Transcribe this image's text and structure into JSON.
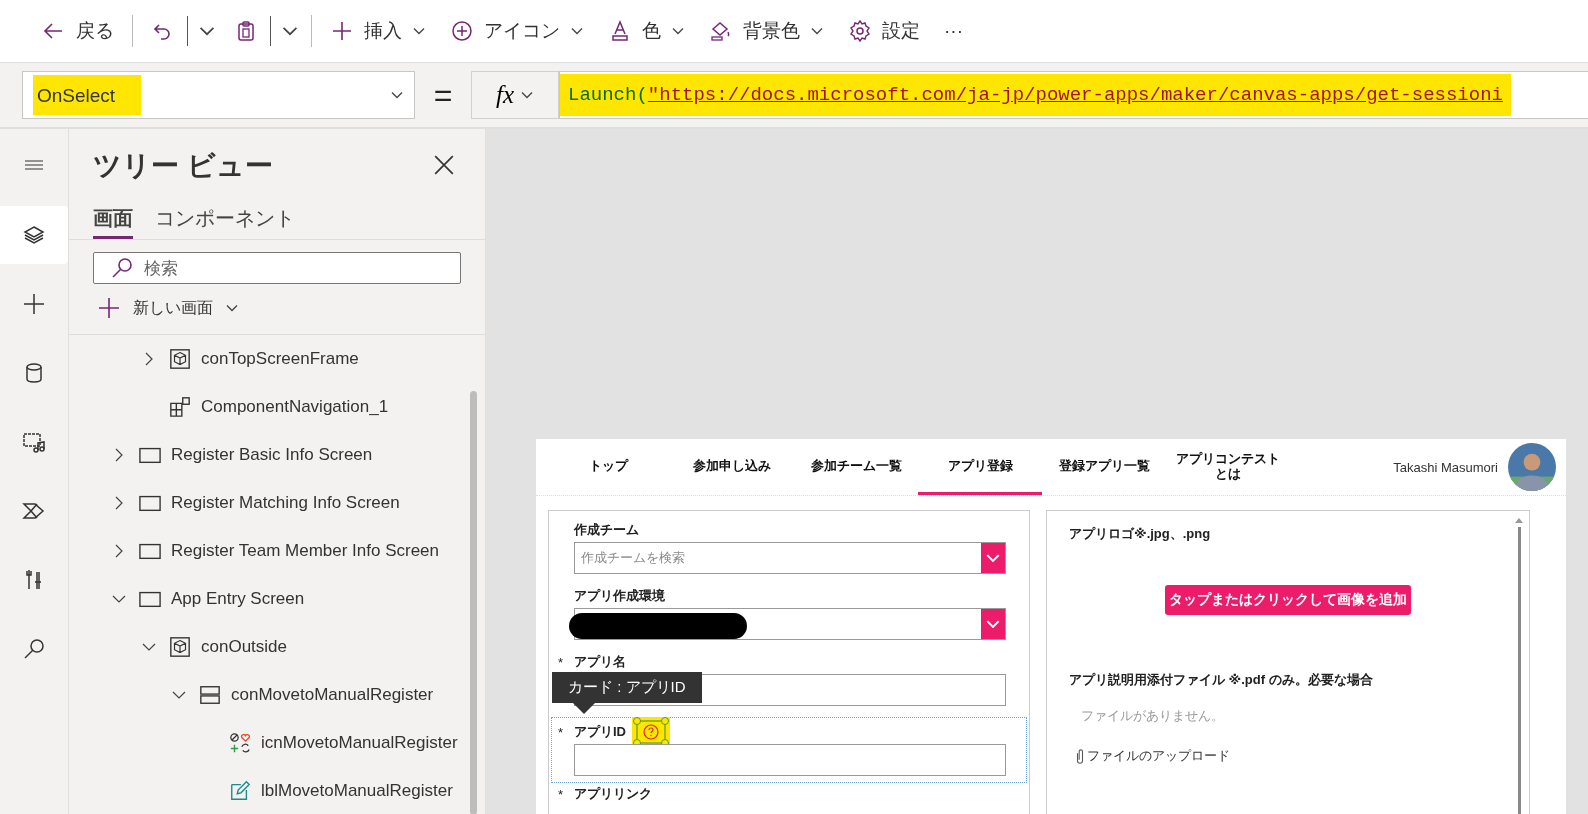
{
  "toolbar": [
    {
      "kind": "back",
      "label": "戻る"
    },
    {
      "kind": "separator"
    },
    {
      "kind": "undo"
    },
    {
      "kind": "split_caret"
    },
    {
      "kind": "paste"
    },
    {
      "kind": "split_caret"
    },
    {
      "kind": "separator"
    },
    {
      "kind": "insert",
      "label": "挿入",
      "caret": true
    },
    {
      "kind": "icon",
      "label": "アイコン",
      "caret": true
    },
    {
      "kind": "color",
      "label": "色",
      "caret": true
    },
    {
      "kind": "background",
      "label": "背景色",
      "caret": true
    },
    {
      "kind": "settings",
      "label": "設定",
      "caret": false
    },
    {
      "kind": "more",
      "label": "···",
      "caret": false
    }
  ],
  "formula_bar": {
    "property": "OnSelect",
    "equals": "=",
    "fx": "fx",
    "function": "Launch(",
    "string": "\"https://docs.microsoft.com/ja-jp/power-apps/maker/canvas-apps/get-sessioni"
  },
  "rail": [
    {
      "kind": "menu",
      "selected": false
    },
    {
      "kind": "layers",
      "selected": true
    },
    {
      "kind": "insert",
      "selected": false
    },
    {
      "kind": "data",
      "selected": false
    },
    {
      "kind": "media",
      "selected": false
    },
    {
      "kind": "automate",
      "selected": false
    },
    {
      "kind": "tools",
      "selected": false
    },
    {
      "kind": "search",
      "selected": false
    }
  ],
  "tree_view": {
    "title": "ツリー ビュー",
    "tabs": [
      {
        "label": "画面",
        "selected": true
      },
      {
        "label": "コンポーネント",
        "selected": false
      }
    ],
    "search": {
      "placeholder": "検索"
    },
    "new_screen": "新しい画面",
    "items": [
      {
        "kind": "hidden",
        "children": [
          {
            "kind": "container",
            "label": "conTopScreenFrame",
            "expanded": false
          },
          {
            "kind": "component",
            "label": "ComponentNavigation_1"
          }
        ]
      },
      {
        "kind": "screen",
        "label": "Register Basic Info Screen",
        "expanded": false
      },
      {
        "kind": "screen",
        "label": "Register Matching Info Screen",
        "expanded": false
      },
      {
        "kind": "screen",
        "label": "Register Team Member Info Screen",
        "expanded": false
      },
      {
        "kind": "screen",
        "label": "App Entry Screen",
        "expanded": true,
        "children": [
          {
            "kind": "container",
            "label": "conOutside",
            "expanded": true,
            "children": [
              {
                "kind": "layout",
                "label": "conMovetoManualRegister",
                "expanded": true,
                "children": [
                  {
                    "kind": "icon",
                    "label": "icnMovetoManualRegister"
                  },
                  {
                    "kind": "label",
                    "label": "lblMovetoManualRegister"
                  }
                ]
              }
            ]
          }
        ]
      }
    ]
  },
  "app": {
    "nav": [
      {
        "label": "トップ",
        "selected": false
      },
      {
        "label": "参加申し込み",
        "selected": false
      },
      {
        "label": "参加チーム一覧",
        "selected": false
      },
      {
        "label": "アプリ登録",
        "selected": true
      },
      {
        "label": "登録アプリ一覧",
        "selected": false
      },
      {
        "label": "アプリコンテストとは",
        "selected": false
      }
    ],
    "user_name": "Takashi Masumori",
    "fields": [
      {
        "kind": "dropdown",
        "label": "作成チーム",
        "required": false,
        "placeholder": "作成チームを検索",
        "redacted": false,
        "selected": false
      },
      {
        "kind": "dropdown",
        "label": "アプリ作成環境",
        "required": false,
        "redacted": true,
        "selected": false
      },
      {
        "kind": "text",
        "label": "アプリ名",
        "required": true,
        "selected": false
      },
      {
        "kind": "text",
        "label": "アプリID",
        "required": true,
        "selected": true,
        "tooltip": "カード : アプリID"
      },
      {
        "kind": "label_only",
        "label": "アプリリンク",
        "required": true,
        "selected": false
      }
    ],
    "required_mark": "*",
    "logo_label": "アプリロゴ※.jpg、.png",
    "add_image": "タップまたはクリックして画像を追加",
    "attachment_label": "アプリ説明用添付ファイル ※.pdf のみ。必要な場合",
    "no_files": "ファイルがありません。",
    "upload": "ファイルのアップロード"
  }
}
